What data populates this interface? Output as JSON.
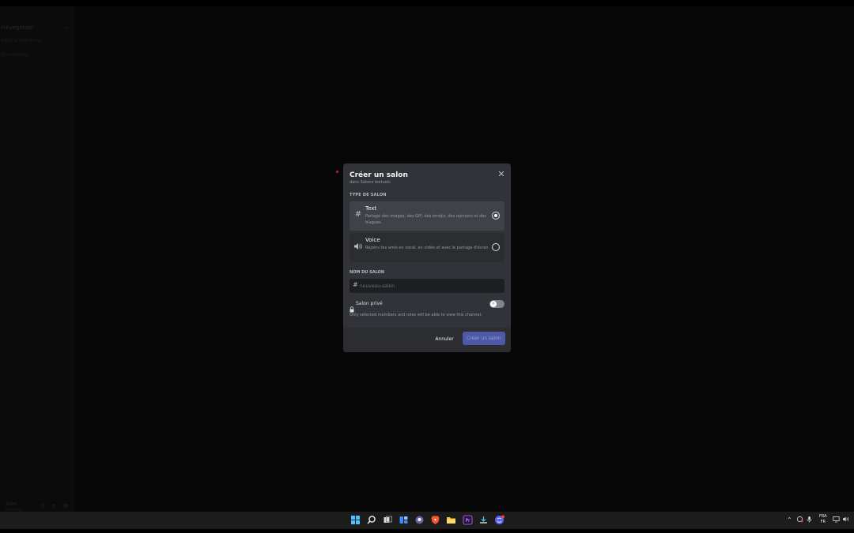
{
  "background": {
    "server_name": "Inkvégétale",
    "sidebar_lines": [
      "Infos & annonces",
      "Discussions"
    ],
    "user_name": "Tolm",
    "user_status": "En ligne"
  },
  "modal": {
    "title": "Créer un salon",
    "subtitle": "dans Salons textuels",
    "channel_type_label": "TYPE DE SALON",
    "options": [
      {
        "icon": "hash-icon",
        "title": "Text",
        "description": "Partage des images, des GIF, des émojis, des opinions et des blagues.",
        "selected": true
      },
      {
        "icon": "speaker-icon",
        "title": "Voice",
        "description": "Rejoins tes amis en vocal, en vidéo et avec le partage d'écran",
        "selected": false
      }
    ],
    "name_label": "NOM DU SALON",
    "name_placeholder": "nouveau-salon",
    "name_prefix": "#",
    "private_label": "Salon privé",
    "private_enabled": false,
    "private_description": "Only selected members and roles will be able to view this channel.",
    "cancel_label": "Annuler",
    "create_label": "Créer un salon",
    "close_symbol": "✕"
  },
  "taskbar": {
    "apps": [
      "windows-start-icon",
      "search-icon",
      "task-view-icon",
      "widgets-icon",
      "chat-icon",
      "brave-icon",
      "file-explorer-icon",
      "premiere-icon",
      "obs-icon",
      "discord-icon"
    ],
    "lang_line1": "FRA",
    "lang_line2": "FR"
  },
  "colors": {
    "modal_bg": "#313338",
    "footer_bg": "#2b2d31",
    "accent": "#5865f2",
    "cursor": "#d4145a"
  }
}
